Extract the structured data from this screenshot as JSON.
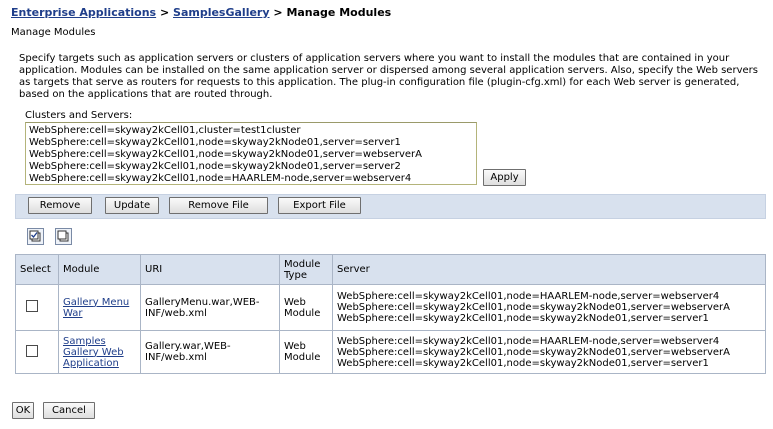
{
  "breadcrumb": {
    "link1": "Enterprise Applications",
    "sep1": ">",
    "link2": "SamplesGallery",
    "sep2": ">",
    "current": "Manage Modules"
  },
  "subtitle": "Manage Modules",
  "description": "Specify targets such as application servers or clusters of application servers where you want to install the modules that are contained in your application. Modules can be installed on the same application server or dispersed among several application servers. Also, specify the Web servers as targets that serve as routers for requests to this application. The plug-in configuration file (plugin-cfg.xml) for each Web server is generated, based on the applications that are routed through.",
  "clusters": {
    "label": "Clusters and Servers:",
    "items": [
      "WebSphere:cell=skyway2kCell01,cluster=test1cluster",
      "WebSphere:cell=skyway2kCell01,node=skyway2kNode01,server=server1",
      "WebSphere:cell=skyway2kCell01,node=skyway2kNode01,server=webserverA",
      "WebSphere:cell=skyway2kCell01,node=skyway2kNode01,server=server2",
      "WebSphere:cell=skyway2kCell01,node=HAARLEM-node,server=webserver4"
    ],
    "apply_label": "Apply"
  },
  "toolbar": {
    "remove": "Remove",
    "update": "Update",
    "remove_file": "Remove File",
    "export_file": "Export File"
  },
  "icons": {
    "select_all": "select-all-icon",
    "deselect_all": "deselect-all-icon"
  },
  "table": {
    "headers": {
      "select": "Select",
      "module": "Module",
      "uri": "URI",
      "module_type": "Module Type",
      "server": "Server"
    },
    "rows": [
      {
        "module": "Gallery Menu War",
        "uri": "GalleryMenu.war,WEB-INF/web.xml",
        "type": "Web Module",
        "servers": [
          "WebSphere:cell=skyway2kCell01,node=HAARLEM-node,server=webserver4",
          "WebSphere:cell=skyway2kCell01,node=skyway2kNode01,server=webserverA",
          "WebSphere:cell=skyway2kCell01,node=skyway2kNode01,server=server1"
        ]
      },
      {
        "module": "Samples Gallery Web Application",
        "uri": "Gallery.war,WEB-INF/web.xml",
        "type": "Web Module",
        "servers": [
          "WebSphere:cell=skyway2kCell01,node=HAARLEM-node,server=webserver4",
          "WebSphere:cell=skyway2kCell01,node=skyway2kNode01,server=webserverA",
          "WebSphere:cell=skyway2kCell01,node=skyway2kNode01,server=server1"
        ]
      }
    ]
  },
  "footer": {
    "ok": "OK",
    "cancel": "Cancel"
  },
  "colors": {
    "link": "#1f3e8a",
    "toolbar_bg": "#d8e1ee",
    "table_border": "#aab5c6"
  }
}
